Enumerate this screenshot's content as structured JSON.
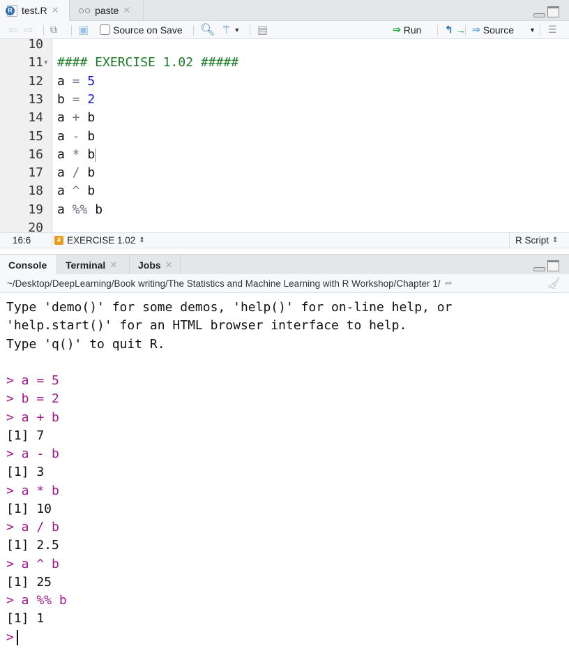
{
  "editor_tabs": [
    {
      "label": "test.R",
      "icon": "r-file-icon"
    },
    {
      "label": "paste",
      "icon": "glasses-icon"
    }
  ],
  "toolbar": {
    "source_on_save": "Source on Save",
    "run": "Run",
    "source": "Source"
  },
  "editor": {
    "lines": [
      {
        "n": "10",
        "tokens": []
      },
      {
        "n": "11",
        "fold": true,
        "tokens": [
          {
            "t": "#### EXERCISE 1.02 #####",
            "k": "comment"
          }
        ]
      },
      {
        "n": "12",
        "tokens": [
          {
            "t": "a",
            "k": "ident"
          },
          {
            "t": " = ",
            "k": "op"
          },
          {
            "t": "5",
            "k": "number"
          }
        ]
      },
      {
        "n": "13",
        "tokens": [
          {
            "t": "b",
            "k": "ident"
          },
          {
            "t": " = ",
            "k": "op"
          },
          {
            "t": "2",
            "k": "number"
          }
        ]
      },
      {
        "n": "14",
        "tokens": [
          {
            "t": "a",
            "k": "ident"
          },
          {
            "t": " + ",
            "k": "op"
          },
          {
            "t": "b",
            "k": "ident"
          }
        ]
      },
      {
        "n": "15",
        "tokens": [
          {
            "t": "a",
            "k": "ident"
          },
          {
            "t": " - ",
            "k": "op"
          },
          {
            "t": "b",
            "k": "ident"
          }
        ]
      },
      {
        "n": "16",
        "cursor": true,
        "tokens": [
          {
            "t": "a",
            "k": "ident"
          },
          {
            "t": " * ",
            "k": "op"
          },
          {
            "t": "b",
            "k": "ident"
          }
        ]
      },
      {
        "n": "17",
        "tokens": [
          {
            "t": "a",
            "k": "ident"
          },
          {
            "t": " / ",
            "k": "op"
          },
          {
            "t": "b",
            "k": "ident"
          }
        ]
      },
      {
        "n": "18",
        "tokens": [
          {
            "t": "a",
            "k": "ident"
          },
          {
            "t": " ^ ",
            "k": "op"
          },
          {
            "t": "b",
            "k": "ident"
          }
        ]
      },
      {
        "n": "19",
        "tokens": [
          {
            "t": "a",
            "k": "ident"
          },
          {
            "t": " %% ",
            "k": "op"
          },
          {
            "t": "b",
            "k": "ident"
          }
        ]
      },
      {
        "n": "20",
        "tokens": []
      }
    ]
  },
  "status": {
    "position": "16:6",
    "section": "EXERCISE 1.02",
    "filetype": "R Script"
  },
  "console_tabs": [
    {
      "label": "Console"
    },
    {
      "label": "Terminal",
      "closable": true
    },
    {
      "label": "Jobs",
      "closable": true
    }
  ],
  "console_path": "~/Desktop/DeepLearning/Book writing/The Statistics and Machine Learning with R Workshop/Chapter 1/",
  "console_lines": [
    {
      "t": "Type 'demo()' for some demos, 'help()' for on-line help, or",
      "k": "out"
    },
    {
      "t": "'help.start()' for an HTML browser interface to help.",
      "k": "out"
    },
    {
      "t": "Type 'q()' to quit R.",
      "k": "out"
    },
    {
      "t": "",
      "k": "out"
    },
    {
      "t": "> a = 5",
      "k": "in"
    },
    {
      "t": "> b = 2",
      "k": "in"
    },
    {
      "t": "> a + b",
      "k": "in"
    },
    {
      "t": "[1] 7",
      "k": "out"
    },
    {
      "t": "> a - b",
      "k": "in"
    },
    {
      "t": "[1] 3",
      "k": "out"
    },
    {
      "t": "> a * b",
      "k": "in"
    },
    {
      "t": "[1] 10",
      "k": "out"
    },
    {
      "t": "> a / b",
      "k": "in"
    },
    {
      "t": "[1] 2.5",
      "k": "out"
    },
    {
      "t": "> a ^ b",
      "k": "in"
    },
    {
      "t": "[1] 25",
      "k": "out"
    },
    {
      "t": "> a %% b",
      "k": "in"
    },
    {
      "t": "[1] 1",
      "k": "out"
    },
    {
      "t": ">",
      "k": "in",
      "cursor": true
    }
  ]
}
